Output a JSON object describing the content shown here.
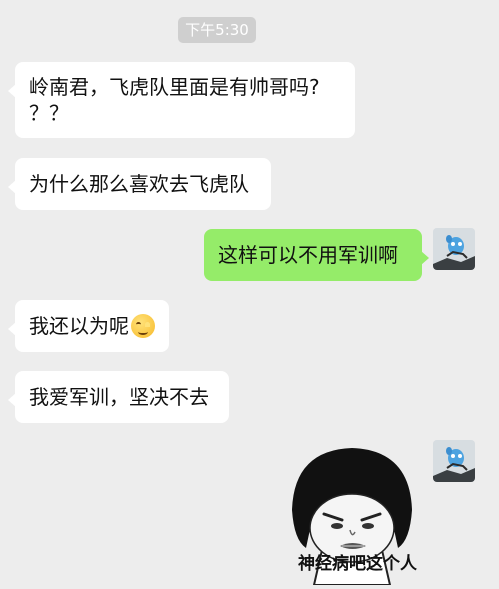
{
  "status": {
    "time": "下午5:30"
  },
  "messages": [
    {
      "side": "left",
      "text_line1": "岭南君，飞虎队里面是有帅哥吗?",
      "text_line2": "？？"
    },
    {
      "side": "left",
      "text": "为什么那么喜欢去飞虎队"
    },
    {
      "side": "right",
      "text": "这样可以不用军训啊"
    },
    {
      "side": "left",
      "text": "我还以为呢",
      "emoji": "smiling-blush-emoji"
    },
    {
      "side": "left",
      "text": "我爱军训，坚决不去"
    },
    {
      "side": "right",
      "sticker_caption": "神经病吧这个人"
    }
  ],
  "colors": {
    "background": "#ededed",
    "left_bubble": "#ffffff",
    "right_bubble": "#95ec69"
  },
  "icons": {
    "avatar": "blue-cartoon-avatar",
    "sticker": "mushroom-head-meme-face"
  }
}
